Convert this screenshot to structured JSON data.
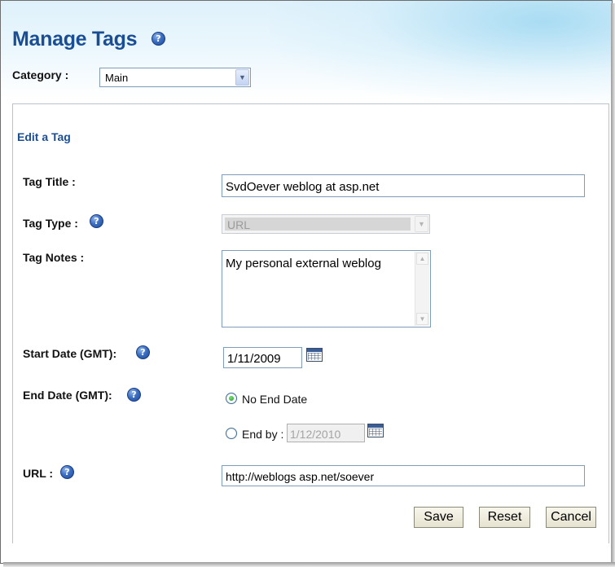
{
  "page": {
    "title": "Manage Tags",
    "help_icon": "help-icon"
  },
  "category": {
    "label": "Category :",
    "selected": "Main"
  },
  "panel": {
    "heading": "Edit a Tag"
  },
  "form": {
    "tag_title": {
      "label": "Tag Title :",
      "value": "SvdOever weblog at asp.net"
    },
    "tag_type": {
      "label": "Tag Type :",
      "selected": "URL",
      "disabled": true
    },
    "tag_notes": {
      "label": "Tag Notes :",
      "value": "My personal external weblog"
    },
    "start_date": {
      "label": "Start Date (GMT):",
      "value": "1/11/2009",
      "icon": "calendar-icon"
    },
    "end_date": {
      "label": "End Date (GMT):",
      "option_no_end": "No End Date",
      "option_end_by": "End by :",
      "end_by_value": "1/12/2010",
      "selected_option": "No End Date",
      "icon": "calendar-icon"
    },
    "url": {
      "label": "URL :",
      "value": "http://weblogs asp.net/soever"
    }
  },
  "buttons": {
    "save": "Save",
    "reset": "Reset",
    "cancel": "Cancel"
  },
  "colors": {
    "title": "#1a4e94",
    "heading": "#1a4e94",
    "help_icon": "#3c6fc4",
    "button_bg": "#e7e3d1"
  }
}
